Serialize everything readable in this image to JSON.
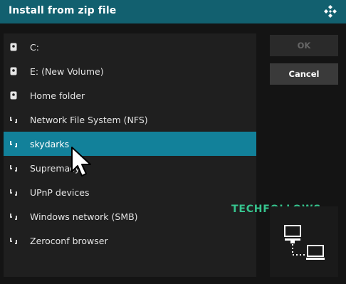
{
  "dialog": {
    "title": "Install from zip file",
    "logo_icon": "kodi-logo-icon"
  },
  "sources": [
    {
      "label": "C:",
      "icon": "drive-icon",
      "selected": false
    },
    {
      "label": "E: (New Volume)",
      "icon": "drive-icon",
      "selected": false
    },
    {
      "label": "Home folder",
      "icon": "drive-icon",
      "selected": false
    },
    {
      "label": "Network File System (NFS)",
      "icon": "network-share-icon",
      "selected": false
    },
    {
      "label": "skydarks",
      "icon": "network-share-icon",
      "selected": true
    },
    {
      "label": "Supremacy",
      "icon": "network-share-icon",
      "selected": false
    },
    {
      "label": "UPnP devices",
      "icon": "network-share-icon",
      "selected": false
    },
    {
      "label": "Windows network (SMB)",
      "icon": "network-share-icon",
      "selected": false
    },
    {
      "label": "Zeroconf browser",
      "icon": "network-share-icon",
      "selected": false
    }
  ],
  "buttons": {
    "ok_label": "OK",
    "ok_enabled": false,
    "cancel_label": "Cancel"
  },
  "preview": {
    "icon": "network-computers-icon"
  },
  "watermark": "TECHFOLLOWS",
  "colors": {
    "accent": "#12819a",
    "titlebar": "#12606f",
    "watermark": "#36c48e"
  }
}
